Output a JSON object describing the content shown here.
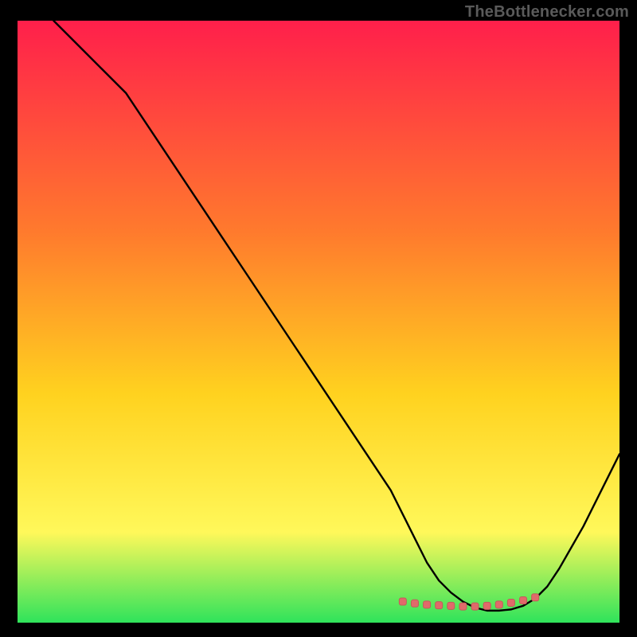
{
  "watermark": "TheBottlenecker.com",
  "colors": {
    "gradient_top": "#ff1f4b",
    "gradient_mid1": "#ff7a2d",
    "gradient_mid2": "#ffd21f",
    "gradient_mid3": "#fff85a",
    "gradient_bottom": "#2fe35b",
    "curve": "#000000",
    "marker_fill": "#e06a6a",
    "marker_stroke": "#c35a5a",
    "frame": "#000000"
  },
  "chart_data": {
    "type": "line",
    "title": "",
    "xlabel": "",
    "ylabel": "",
    "xlim": [
      0,
      100
    ],
    "ylim": [
      0,
      100
    ],
    "curve": {
      "x": [
        6,
        10,
        14,
        18,
        22,
        26,
        30,
        34,
        38,
        42,
        46,
        50,
        54,
        58,
        62,
        64,
        66,
        68,
        70,
        72,
        74,
        76,
        78,
        80,
        82,
        84,
        86,
        88,
        90,
        92,
        94,
        96,
        98,
        100
      ],
      "y": [
        100,
        96,
        92,
        88,
        82,
        76,
        70,
        64,
        58,
        52,
        46,
        40,
        34,
        28,
        22,
        18,
        14,
        10,
        7,
        5,
        3.5,
        2.5,
        2,
        2,
        2.2,
        2.8,
        4,
        6,
        9,
        12.5,
        16,
        20,
        24,
        28
      ]
    },
    "markers": {
      "x": [
        64,
        66,
        68,
        70,
        72,
        74,
        76,
        78,
        80,
        82,
        84,
        86
      ],
      "y": [
        3.5,
        3.2,
        3.0,
        2.9,
        2.8,
        2.7,
        2.7,
        2.8,
        3.0,
        3.3,
        3.7,
        4.2
      ]
    },
    "grid": false,
    "legend": false
  }
}
